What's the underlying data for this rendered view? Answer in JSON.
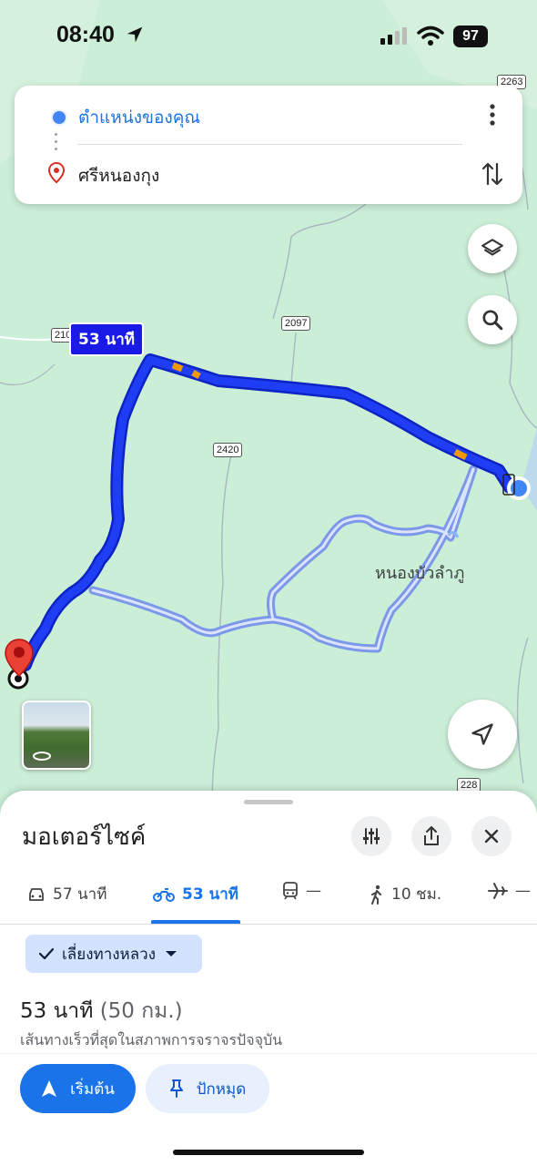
{
  "status_bar": {
    "time": "08:40",
    "battery": "97"
  },
  "directions": {
    "origin": "ตำแหน่งของคุณ",
    "destination": "ศรีหนองกุง"
  },
  "map": {
    "route_duration_label": "53 นาที",
    "place_label": "หนองบัวลำภู",
    "road_shields": [
      "2263",
      "210",
      "2097",
      "2420",
      "228"
    ]
  },
  "sheet": {
    "title": "มอเตอร์ไซค์",
    "modes": [
      {
        "icon": "car-icon",
        "label": "57 นาที"
      },
      {
        "icon": "motorcycle-icon",
        "label": "53 นาที"
      },
      {
        "icon": "transit-icon",
        "label": "—"
      },
      {
        "icon": "walk-icon",
        "label": "10 ชม."
      },
      {
        "icon": "flight-icon",
        "label": "—"
      }
    ],
    "active_mode_index": 1,
    "option_chip": "เลี่ยงทางหลวง",
    "route_time": "53 นาที",
    "route_distance": "(50 กม.)",
    "route_description": "เส้นทางเร็วที่สุดในสภาพการจราจรปัจจุบัน",
    "start_label": "เริ่มต้น",
    "pin_label": "ปักหมุด"
  },
  "colors": {
    "accent": "#1a73e8",
    "route": "#1a1ae6",
    "map_bg": "#cbeed7"
  }
}
